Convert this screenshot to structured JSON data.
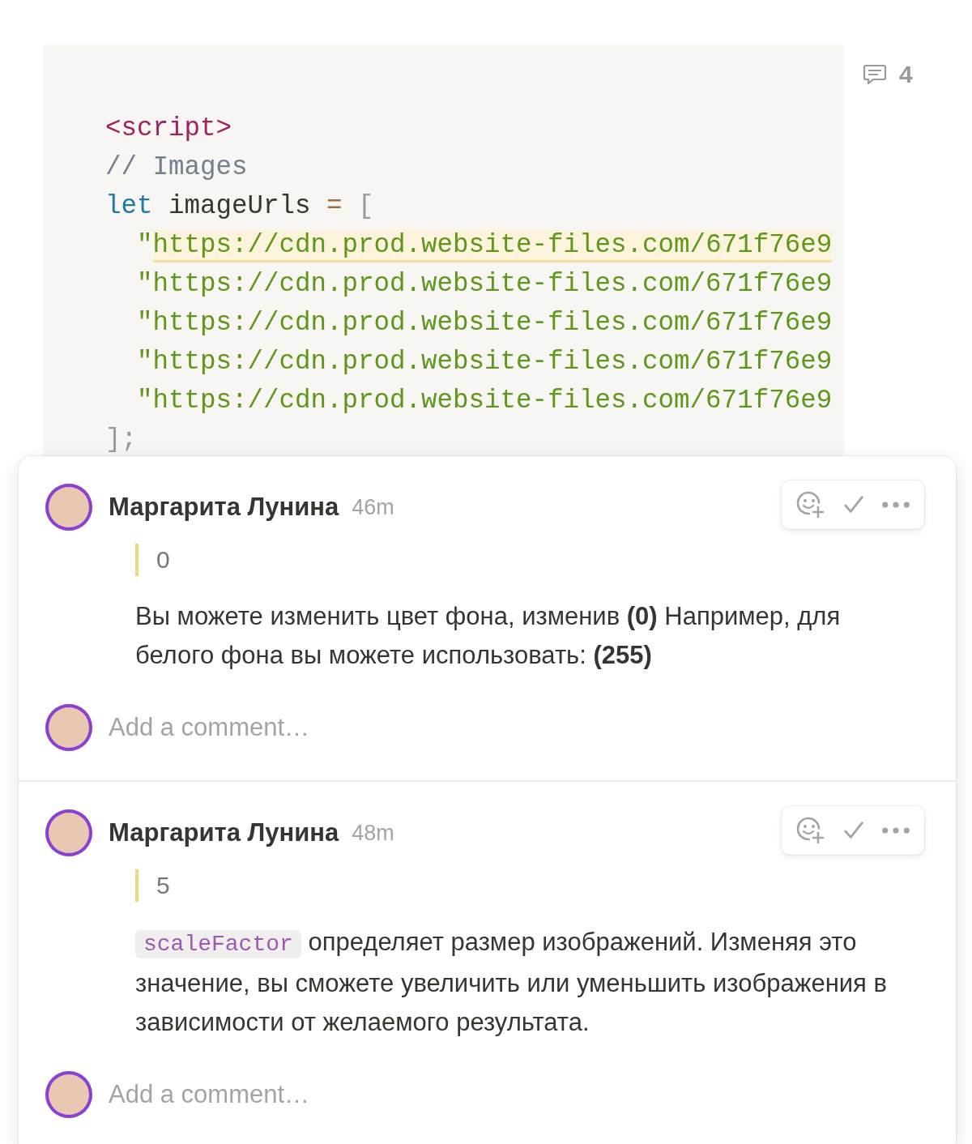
{
  "code_block": {
    "lines": [
      [
        {
          "kind": "tag",
          "text": "<script>"
        }
      ],
      [
        {
          "kind": "comment",
          "text": "// Images"
        }
      ],
      [
        {
          "kind": "keyword",
          "text": "let"
        },
        {
          "kind": "plain",
          "text": " imageUrls "
        },
        {
          "kind": "operator",
          "text": "="
        },
        {
          "kind": "punct",
          "text": " ["
        }
      ],
      [
        {
          "kind": "string",
          "text": "  \""
        },
        {
          "kind": "string",
          "text": "https://cdn.prod.website-files.com/671f76e9",
          "highlighted": true
        }
      ],
      [
        {
          "kind": "string",
          "text": "  \"https://cdn.prod.website-files.com/671f76e9"
        }
      ],
      [
        {
          "kind": "string",
          "text": "  \"https://cdn.prod.website-files.com/671f76e9"
        }
      ],
      [
        {
          "kind": "string",
          "text": "  \"https://cdn.prod.website-files.com/671f76e9"
        }
      ],
      [
        {
          "kind": "string",
          "text": "  \"https://cdn.prod.website-files.com/671f76e9"
        }
      ],
      [
        {
          "kind": "punct",
          "text": "];"
        }
      ]
    ]
  },
  "comment_count": "4",
  "threads": [
    {
      "author": "Маргарита Лунина",
      "time": "46m",
      "quote": "0",
      "body": [
        {
          "kind": "text",
          "text": "Вы можете изменить цвет фона, изменив **(0)** Например, для белого фона вы можете использовать: **(255)**"
        }
      ],
      "reply_placeholder": "Add a comment…"
    },
    {
      "author": "Маргарита Лунина",
      "time": "48m",
      "quote": "5",
      "body": [
        {
          "kind": "code",
          "text": "scaleFactor"
        },
        {
          "kind": "text",
          "text": "определяет размер изображений. Изменяя это значение, вы сможете увеличить или уменьшить изображения в зависимости от желаемого результата."
        }
      ],
      "reply_placeholder": "Add a comment…"
    }
  ]
}
